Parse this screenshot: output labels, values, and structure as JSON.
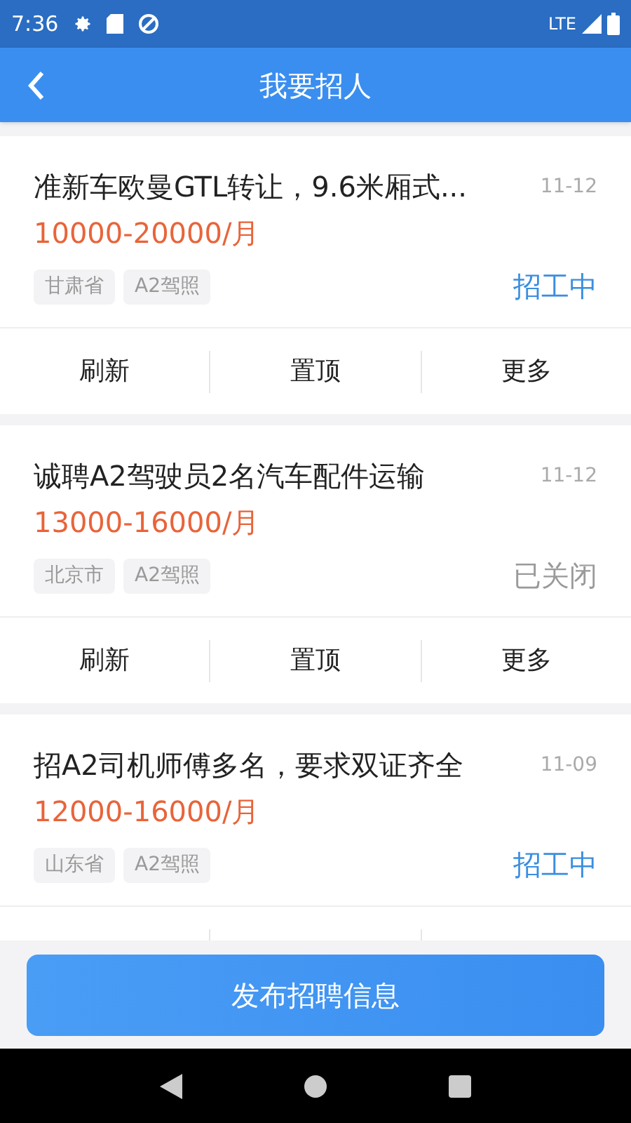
{
  "status_bar": {
    "time": "7:36",
    "network": "LTE"
  },
  "header": {
    "title": "我要招人"
  },
  "jobs": [
    {
      "title": "准新车欧曼GTL转让，9.6米厢式...",
      "date": "11-12",
      "salary": "10000-20000/月",
      "tags": [
        "甘肃省",
        "A2驾照"
      ],
      "status": "招工中",
      "kind": "recruiting",
      "actions": [
        "刷新",
        "置顶",
        "更多"
      ]
    },
    {
      "title": "诚聘A2驾驶员2名汽车配件运输",
      "date": "11-12",
      "salary": "13000-16000/月",
      "tags": [
        "北京市",
        "A2驾照"
      ],
      "status": "已关闭",
      "kind": "closed",
      "actions": [
        "刷新",
        "置顶",
        "更多"
      ]
    },
    {
      "title": "招A2司机师傅多名，要求双证齐全",
      "date": "11-09",
      "salary": "12000-16000/月",
      "tags": [
        "山东省",
        "A2驾照"
      ],
      "status": "招工中",
      "kind": "recruiting"
    }
  ],
  "publish_button": "发布招聘信息"
}
